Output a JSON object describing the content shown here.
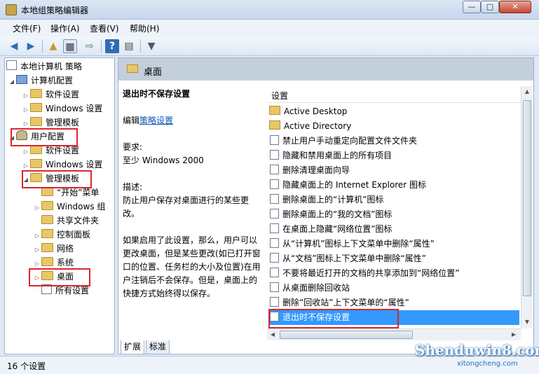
{
  "window": {
    "title": "本地组策略编辑器",
    "min": "—",
    "max": "□",
    "close": "✕"
  },
  "menu": [
    "文件(F)",
    "操作(A)",
    "查看(V)",
    "帮助(H)"
  ],
  "tree": {
    "root": "本地计算机 策略",
    "computer_config": "计算机配置",
    "software_settings_1": "软件设置",
    "windows_settings_1": "Windows 设置",
    "admin_templates_1": "管理模板",
    "user_config": "用户配置",
    "software_settings_2": "软件设置",
    "windows_settings_2": "Windows 设置",
    "admin_templates_2": "管理模板",
    "start_menu": "“开始”菜单",
    "windows_components": "Windows 组",
    "shared_folders": "共享文件夹",
    "control_panel": "控制面板",
    "network": "网络",
    "system": "系统",
    "desktop": "桌面",
    "all_settings": "所有设置"
  },
  "pane": {
    "header": "桌面",
    "desc_title": "退出时不保存设置",
    "edit_prefix": "编辑",
    "edit_link": "策略设置",
    "req_label": "要求:",
    "req_value": "至少 Windows 2000",
    "desc_label": "描述:",
    "desc_text": "防止用户保存对桌面进行的某些更改。",
    "desc_more": "如果启用了此设置，那么，用户可以更改桌面，但是某些更改(如已打开窗口的位置、任务栏的大小及位置)在用户注销后不会保存。但是，桌面上的快捷方式始终得以保存。"
  },
  "list": {
    "column": "设置",
    "rows": [
      "Active Desktop",
      "Active Directory",
      "禁止用户手动重定向配置文件文件夹",
      "隐藏和禁用桌面上的所有项目",
      "删除清理桌面向导",
      "隐藏桌面上的 Internet Explorer 图标",
      "删除桌面上的“计算机”图标",
      "删除桌面上的“我的文档”图标",
      "在桌面上隐藏“网络位置”图标",
      "从“计算机”图标上下文菜单中删除“属性”",
      "从“文档”图标上下文菜单中删除“属性”",
      "不要将最近打开的文档的共享添加到“网络位置”",
      "从桌面删除回收站",
      "删除“回收站”上下文菜单的“属性”",
      "退出时不保存设置"
    ]
  },
  "tabs": [
    "扩展",
    "标准"
  ],
  "status": "16 个设置",
  "watermark": {
    "main": "Shenduwin8.com",
    "sub": "xitongcheng.com"
  },
  "colors": {
    "selection": "#3399ff",
    "highlight_box": "#d9262c",
    "pane_header": "#c4cfdc"
  }
}
